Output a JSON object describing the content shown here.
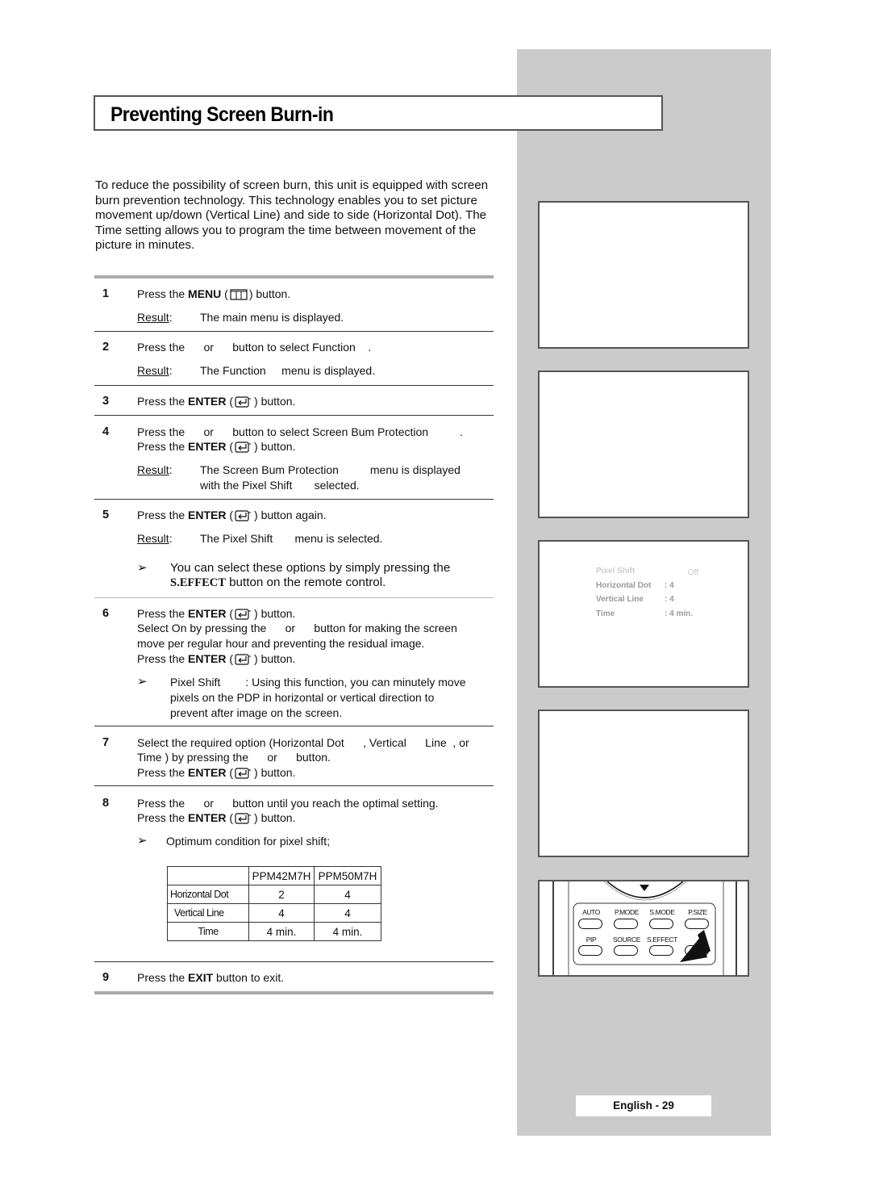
{
  "page": {
    "title": "Preventing Screen Burn-in",
    "intro": "To reduce the possibility of screen burn, this unit is equipped with screen burn prevention technology. This technology enables you to set picture movement up/down (Vertical Line) and side to side (Horizontal Dot). The Time setting allows you to program the time between movement of the picture in minutes.",
    "page_label": "English - 29"
  },
  "steps": {
    "s1": {
      "num": "1",
      "a": "Press the ",
      "b": "MENU",
      "c": " (",
      "d": ") button.",
      "result_label": "Result",
      "colon": ":",
      "result": "The main menu is displayed.",
      "icon": "menu-icon"
    },
    "s2": {
      "num": "2",
      "text": "Press the      or      button to select Function    .",
      "result_label": "Result",
      "colon": ":",
      "result": "The Function     menu is displayed."
    },
    "s3": {
      "num": "3",
      "a": "Press the ",
      "b": "ENTER",
      "c": " (",
      "d": ") button.",
      "icon": "enter-icon"
    },
    "s4": {
      "num": "4",
      "line1": "Press the      or      button to select Screen Bum Protection          .",
      "a": "Press the ",
      "b": "ENTER",
      "c": " (",
      "d": ") button.",
      "result_label": "Result",
      "colon": ":",
      "result1": "The Screen Bum Protection          menu is displayed",
      "result2": "with the Pixel Shift       selected."
    },
    "s5": {
      "num": "5",
      "a": "Press the ",
      "b": "ENTER",
      "c": " (",
      "d": ") button again.",
      "result_label": "Result",
      "colon": ":",
      "result": "The Pixel Shift       menu is selected.",
      "note_arrow": "➢",
      "note1": "You can select these options by simply pressing the",
      "note2_bold": "S.EFFECT",
      "note2_rest": " button on the remote control."
    },
    "s6": {
      "num": "6",
      "a": "Press the ",
      "b": "ENTER",
      "c": " (",
      "d": ") button.",
      "line2": "Select On by pressing the      or      button for making the screen",
      "line3": "move per regular hour and preventing the residual image.",
      "e": "Press the ",
      "f": "ENTER",
      "g": " (",
      "h": ") button.",
      "note_arrow": "➢",
      "note1": "Pixel Shift        : Using this function, you can minutely move",
      "note2": "pixels on the PDP in horizontal or vertical direction to",
      "note3": "prevent after image on the screen."
    },
    "s7": {
      "num": "7",
      "line1": "Select the required option (Horizontal Dot      , Vertical      Line  , or",
      "line2": "Time ) by pressing the      or      button.",
      "a": "Press the ",
      "b": "ENTER",
      "c": " (",
      "d": ") button."
    },
    "s8": {
      "num": "8",
      "line1": "Press the      or      button until you reach the optimal setting.",
      "a": "Press the ",
      "b": "ENTER",
      "c": " (",
      "d": ") button.",
      "note_arrow": "➢",
      "note1": "Optimum condition for pixel shift;"
    },
    "s9": {
      "num": "9",
      "a": "Press the ",
      "b": "EXIT",
      "c": " button to exit."
    }
  },
  "table": {
    "headers": [
      "",
      "PPM42M7H",
      "PPM50M7H"
    ],
    "rows": [
      [
        "Horizontal Dot",
        "2",
        "4"
      ],
      [
        "Vertical Line",
        "4",
        "4"
      ],
      [
        "Time",
        "4 min.",
        "4 min."
      ]
    ]
  },
  "osd": {
    "pixel_shift": "Pixel Shift",
    "pixel_shift_value": "Off",
    "horizontal_dot": "Horizontal Dot",
    "horizontal_dot_value": ": 4",
    "vertical_line": "Vertical Line",
    "vertical_line_value": ": 4",
    "time": "Time",
    "time_value": ": 4 min."
  },
  "remote": {
    "row1": [
      "AUTO",
      "P.MODE",
      "S.MODE",
      "P.SIZE"
    ],
    "row2": [
      "PIP",
      "SOURCE",
      "S.EFFECT",
      ""
    ]
  }
}
